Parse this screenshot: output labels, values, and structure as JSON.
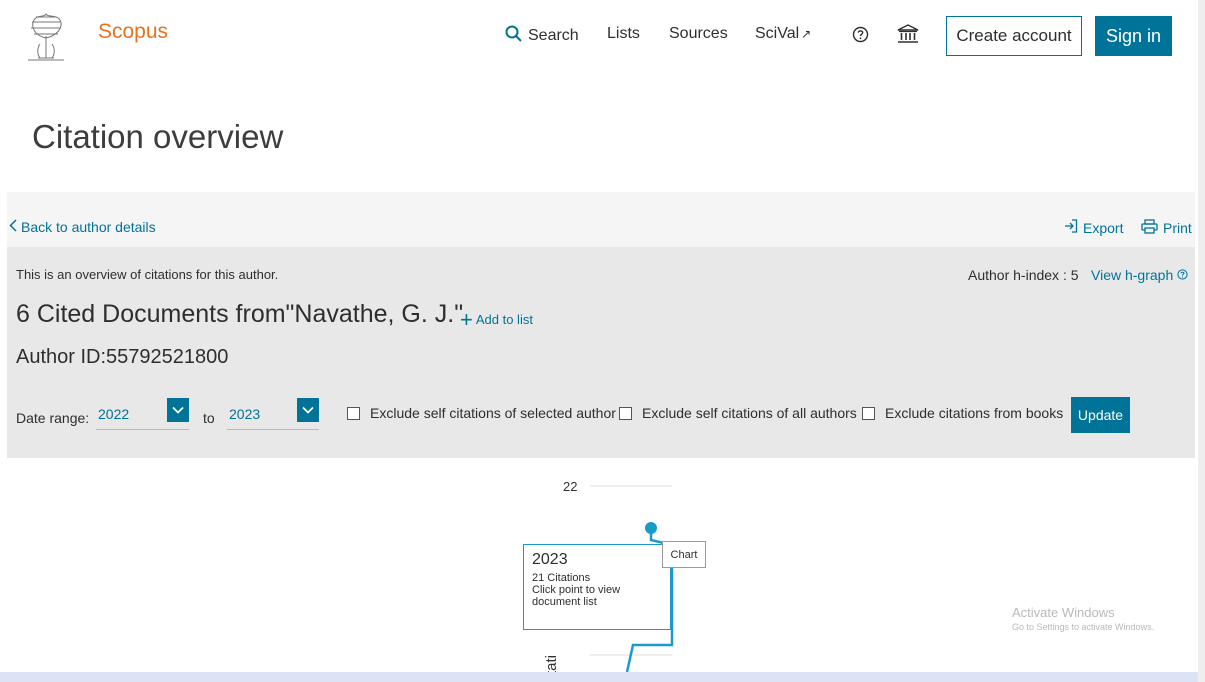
{
  "header": {
    "brand": "Scopus",
    "nav": {
      "search": "Search",
      "lists": "Lists",
      "sources": "Sources",
      "scival": "SciVal",
      "scival_ext": "↗"
    },
    "create_account": "Create account",
    "sign_in": "Sign in"
  },
  "page_title": "Citation overview",
  "toolbar": {
    "back": "Back to author details",
    "export": "Export",
    "print": "Print"
  },
  "overview": {
    "description": "This is an overview of citations for this author.",
    "hindex_label": "Author h-index : 5",
    "hgraph_link": "View h-graph",
    "cited_title": "6 Cited Documents from\"Navathe, G. J.\"",
    "add_to_list": "Add to list",
    "author_id": "Author ID:55792521800"
  },
  "filters": {
    "date_range_label": "Date range:",
    "from_year": "2022",
    "to_word": "to",
    "to_year": "2023",
    "exclude_self_selected": "Exclude self citations of selected author",
    "exclude_self_all": "Exclude self citations of all authors",
    "exclude_books": "Exclude citations from books",
    "update": "Update"
  },
  "chart": {
    "y_tick_top": "22",
    "y_axis_label_fragment": "tati",
    "tooltip_year": "2023",
    "tooltip_citations": "21 Citations",
    "tooltip_hint": "Click point to view document list",
    "badge": "Chart"
  },
  "chart_data": {
    "type": "line",
    "x": [
      "2023"
    ],
    "series": [
      {
        "values": [
          21
        ]
      }
    ],
    "ylabel": "tati",
    "yticks": [
      22
    ]
  },
  "watermark": {
    "line1": "Activate Windows",
    "line2": "Go to Settings to activate Windows."
  },
  "colors": {
    "accent": "#007398",
    "brand": "#e9711c",
    "chart_line": "#1a9acb"
  }
}
